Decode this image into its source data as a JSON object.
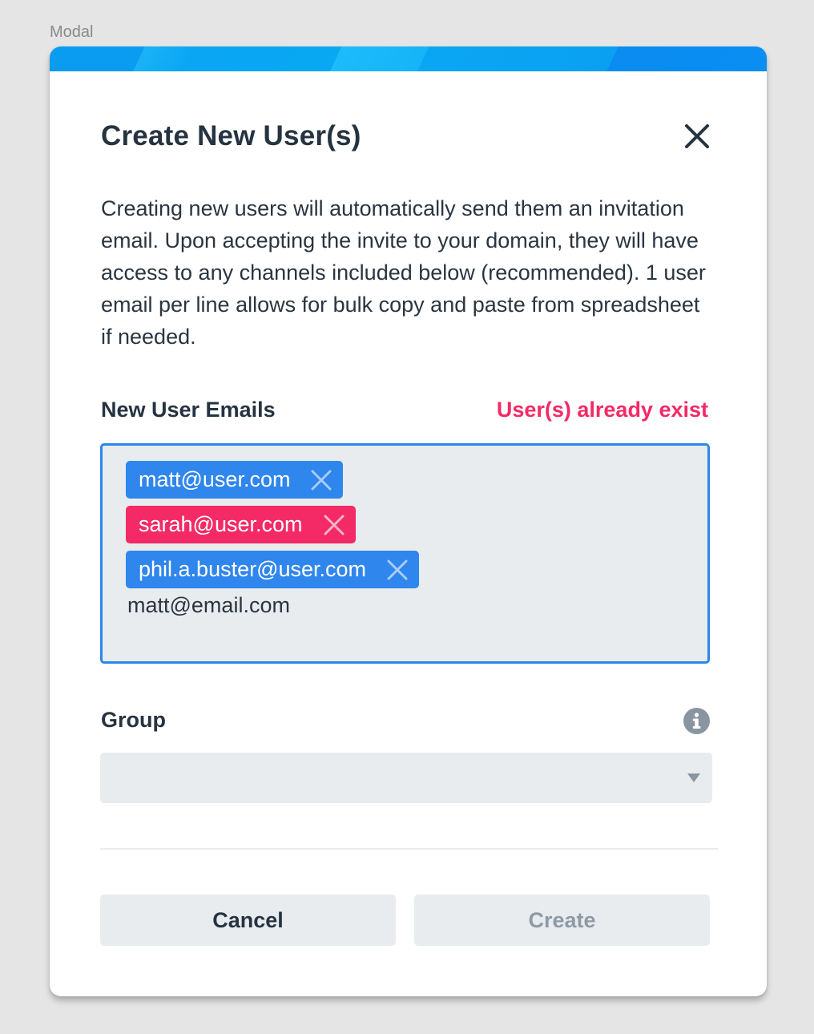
{
  "frame": {
    "label": "Modal"
  },
  "modal": {
    "title": "Create New User(s)",
    "description": "Creating new users will automatically send them an invitation email. Upon accepting the invite to your domain, they will have access to any channels included below (recommended). 1 user email per line allows for bulk copy and paste from spreadsheet if needed.",
    "emails": {
      "label": "New User Emails",
      "error": "User(s) already exist",
      "chips": [
        {
          "email": "matt@user.com",
          "status": "valid"
        },
        {
          "email": "sarah@user.com",
          "status": "exists"
        },
        {
          "email": "phil.a.buster@user.com",
          "status": "valid"
        }
      ],
      "input_value": "matt@email.com"
    },
    "group": {
      "label": "Group",
      "selected": ""
    },
    "buttons": {
      "cancel": "Cancel",
      "create": "Create"
    },
    "colors": {
      "accent_blue": "#2f86ec",
      "error_pink": "#f32a66",
      "field_bg": "#e9ecef"
    }
  }
}
